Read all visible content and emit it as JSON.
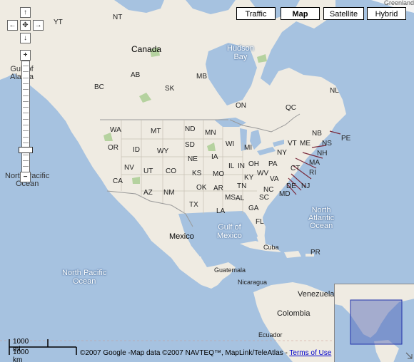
{
  "map_types": [
    {
      "label": "Traffic",
      "selected": false
    },
    {
      "label": "Map",
      "selected": true
    },
    {
      "label": "Satellite",
      "selected": false
    },
    {
      "label": "Hybrid",
      "selected": false
    }
  ],
  "nav": {
    "up": "↑",
    "left": "←",
    "center": "✥",
    "right": "→",
    "down": "↓",
    "zoom_in": "+",
    "zoom_out": "−"
  },
  "countries": {
    "canada": "Canada",
    "mexico": "Mexico",
    "guatemala": "Guatemala",
    "nicaragua": "Nicaragua",
    "venezuela": "Venezuela",
    "colombia": "Colombia",
    "ecuador": "Ecuador",
    "cuba": "Cuba",
    "greenland": "Greenland"
  },
  "provinces": [
    "NT",
    "YT",
    "AB",
    "BC",
    "SK",
    "MB",
    "ON",
    "QC",
    "NL",
    "NB",
    "NS",
    "PE"
  ],
  "states": [
    "WA",
    "OR",
    "ID",
    "MT",
    "WY",
    "ND",
    "SD",
    "NE",
    "CA",
    "NV",
    "UT",
    "CO",
    "AZ",
    "NM",
    "KS",
    "OK",
    "TX",
    "MN",
    "IA",
    "MO",
    "AR",
    "LA",
    "WI",
    "IL",
    "MI",
    "IN",
    "OH",
    "KY",
    "TN",
    "MS",
    "AL",
    "GA",
    "FL",
    "SC",
    "NC",
    "VA",
    "WV",
    "PA",
    "NY",
    "VT",
    "ME",
    "NH",
    "MA",
    "CT",
    "RI",
    "NJ",
    "DE",
    "MD",
    "PR"
  ],
  "waters": {
    "gulf_alaska_1": "Gulf of",
    "gulf_alaska_2": "Alaska",
    "npo_top_1": "North Pacific",
    "npo_top_2": "Ocean",
    "npo_1": "North Pacific",
    "npo_2": "Ocean",
    "hudson_1": "Hudson",
    "hudson_2": "Bay",
    "gom_1": "Gulf of",
    "gom_2": "Mexico",
    "nao_1": "North",
    "nao_2": "Atlantic",
    "nao_3": "Ocean"
  },
  "scale": {
    "miles": "1000 mi",
    "km": "1000 km"
  },
  "copyright": "©2007 Google -Map data ©2007 NAVTEQ™, MapLink/TeleAtlas - ",
  "terms_link": "Terms of Use",
  "colors": {
    "ocean": "#a6c2e0",
    "land": "#efebe2",
    "park": "#b5d29f",
    "ice": "#f6f6f6",
    "border": "#999999"
  }
}
